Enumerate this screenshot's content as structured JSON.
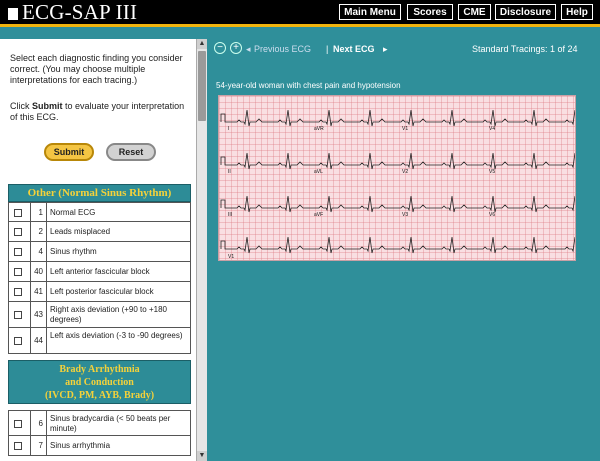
{
  "app": {
    "title": "ECG-SAP III"
  },
  "nav": [
    {
      "label": "Main Menu"
    },
    {
      "label": "Scores"
    },
    {
      "label": "CME"
    },
    {
      "label": "Disclosure"
    },
    {
      "label": "Help"
    }
  ],
  "instructions": {
    "select_text": "Select each diagnostic finding you consider correct. (You may choose multiple interpretations for each tracing.)",
    "click_prefix": "Click ",
    "click_bold": "Submit",
    "click_suffix": " to evaluate your interpretation of this ECG."
  },
  "buttons": {
    "submit": "Submit",
    "reset": "Reset"
  },
  "sections": [
    {
      "title": "Other (Normal Sinus Rhythm)",
      "items": [
        {
          "num": "1",
          "label": "Normal ECG"
        },
        {
          "num": "2",
          "label": "Leads misplaced"
        },
        {
          "num": "4",
          "label": "Sinus rhythm"
        },
        {
          "num": "40",
          "label": "Left anterior fascicular block"
        },
        {
          "num": "41",
          "label": "Left posterior fascicular block"
        },
        {
          "num": "43",
          "label": "Right axis deviation (+90 to +180 degrees)"
        },
        {
          "num": "44",
          "label": "Left axis deviation (-3 to -90 degrees)"
        }
      ]
    },
    {
      "title_lines": [
        "Brady Arrhythmia",
        "and Conduction",
        "(IVCD, PM, AYB, Brady)"
      ],
      "items": [
        {
          "num": "6",
          "label": "Sinus bradycardia (< 50 beats per minute)"
        },
        {
          "num": "7",
          "label": "Sinus arrhythmia"
        }
      ]
    }
  ],
  "toolbar": {
    "prev": "Previous ECG",
    "separator": "|",
    "next": "Next ECG",
    "counter": "Standard Tracings: 1 of 24"
  },
  "ecg": {
    "caption": "54-year-old woman with chest pain and hypotension",
    "leads_row1": [
      "I",
      "aVR",
      "V1",
      "V4"
    ],
    "leads_row2": [
      "II",
      "aVL",
      "V2",
      "V5"
    ],
    "leads_row3": [
      "III",
      "aVF",
      "V3",
      "V6"
    ],
    "leads_row4": [
      "V1"
    ]
  },
  "icons": {
    "zoom_out": "zoom-out-icon",
    "zoom_in": "zoom-in-icon",
    "prev_arrow": "triangle-left-icon",
    "next_arrow": "triangle-right-icon"
  },
  "colors": {
    "accent_teal": "#2f8f9a",
    "header_text": "#f5d23a",
    "bar_orange": "#f1b40d",
    "ecg_paper": "#f9dfe2"
  }
}
